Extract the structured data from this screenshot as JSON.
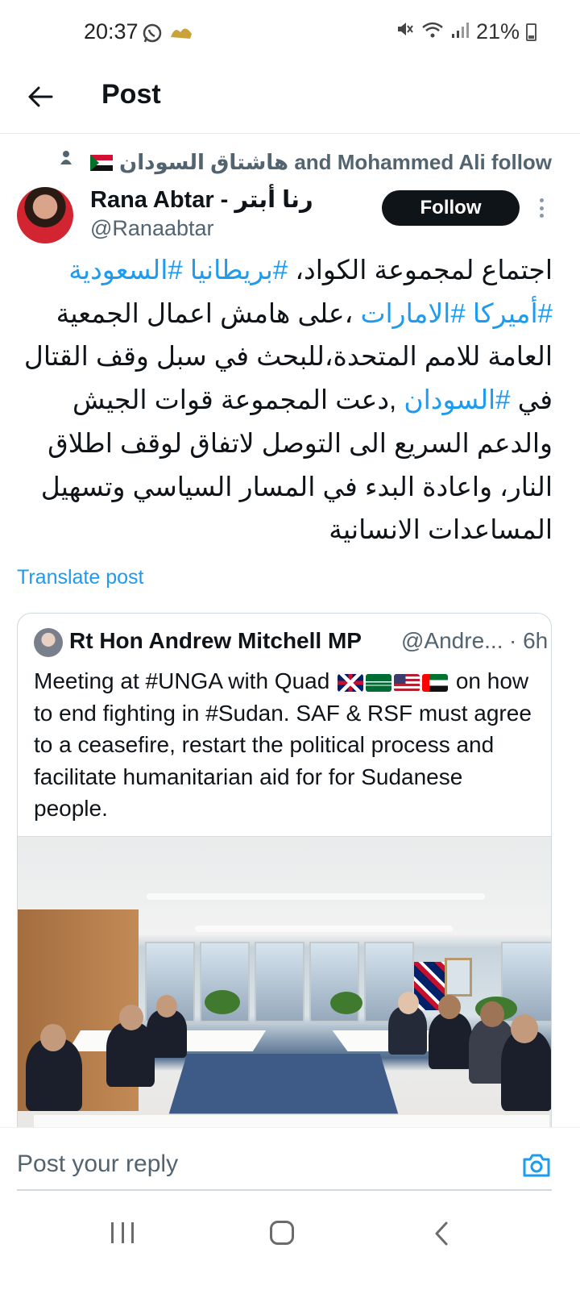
{
  "status_bar": {
    "time": "20:37",
    "battery": "21%",
    "icons": [
      "whatsapp-icon",
      "notification-icon",
      "mute-icon",
      "wifi-icon",
      "signal-icon",
      "battery-icon"
    ]
  },
  "header": {
    "title": "Post",
    "back_icon": "arrow-left-icon"
  },
  "social_context": {
    "text": "هاشتاق السودان and Mohammed Ali follow",
    "icon": "person-icon"
  },
  "post": {
    "author_name": "Rana Abtar - رنا أبتر",
    "author_handle": "@Ranaabtar",
    "follow_label": "Follow",
    "text_parts": [
      "اجتماع لمجموعة الكواد، ",
      "#بريطانيا",
      " ",
      "#السعودية",
      " ",
      "#أميركا",
      " ",
      "#الامارات",
      " ،على هامش اعمال الجمعية العامة للامم المتحدة،للبحث في سبل وقف القتال في ",
      "#السودان",
      " ,دعت المجموعة قوات الجيش والدعم السريع الى التوصل لاتفاق لوقف اطلاق النار، واعادة البدء في المسار السياسي وتسهيل المساعدات الانسانية"
    ],
    "translate_label": "Translate post"
  },
  "quote": {
    "author_name": "Rt Hon Andrew Mitchell MP",
    "author_handle": "@Andre...",
    "time": "· 6h",
    "text_before_flags": "Meeting at #UNGA with Quad",
    "text_after_flags": "on how to end fighting in #Sudan. SAF & RSF must agree to a ceasefire, restart the political process and facilitate humanitarian aid for for Sudanese people.",
    "flags": [
      "uk-flag",
      "saudi-flag",
      "us-flag",
      "uae-flag"
    ],
    "image": "meeting-room-photo"
  },
  "reply": {
    "placeholder": "Post your reply",
    "camera_icon": "camera-icon"
  },
  "nav_bar": {
    "buttons": [
      "recent-apps",
      "home",
      "back"
    ]
  },
  "colors": {
    "link": "#1d9bf0",
    "text": "#0f1419",
    "secondary": "#536471",
    "follow_bg": "#0f1419"
  }
}
